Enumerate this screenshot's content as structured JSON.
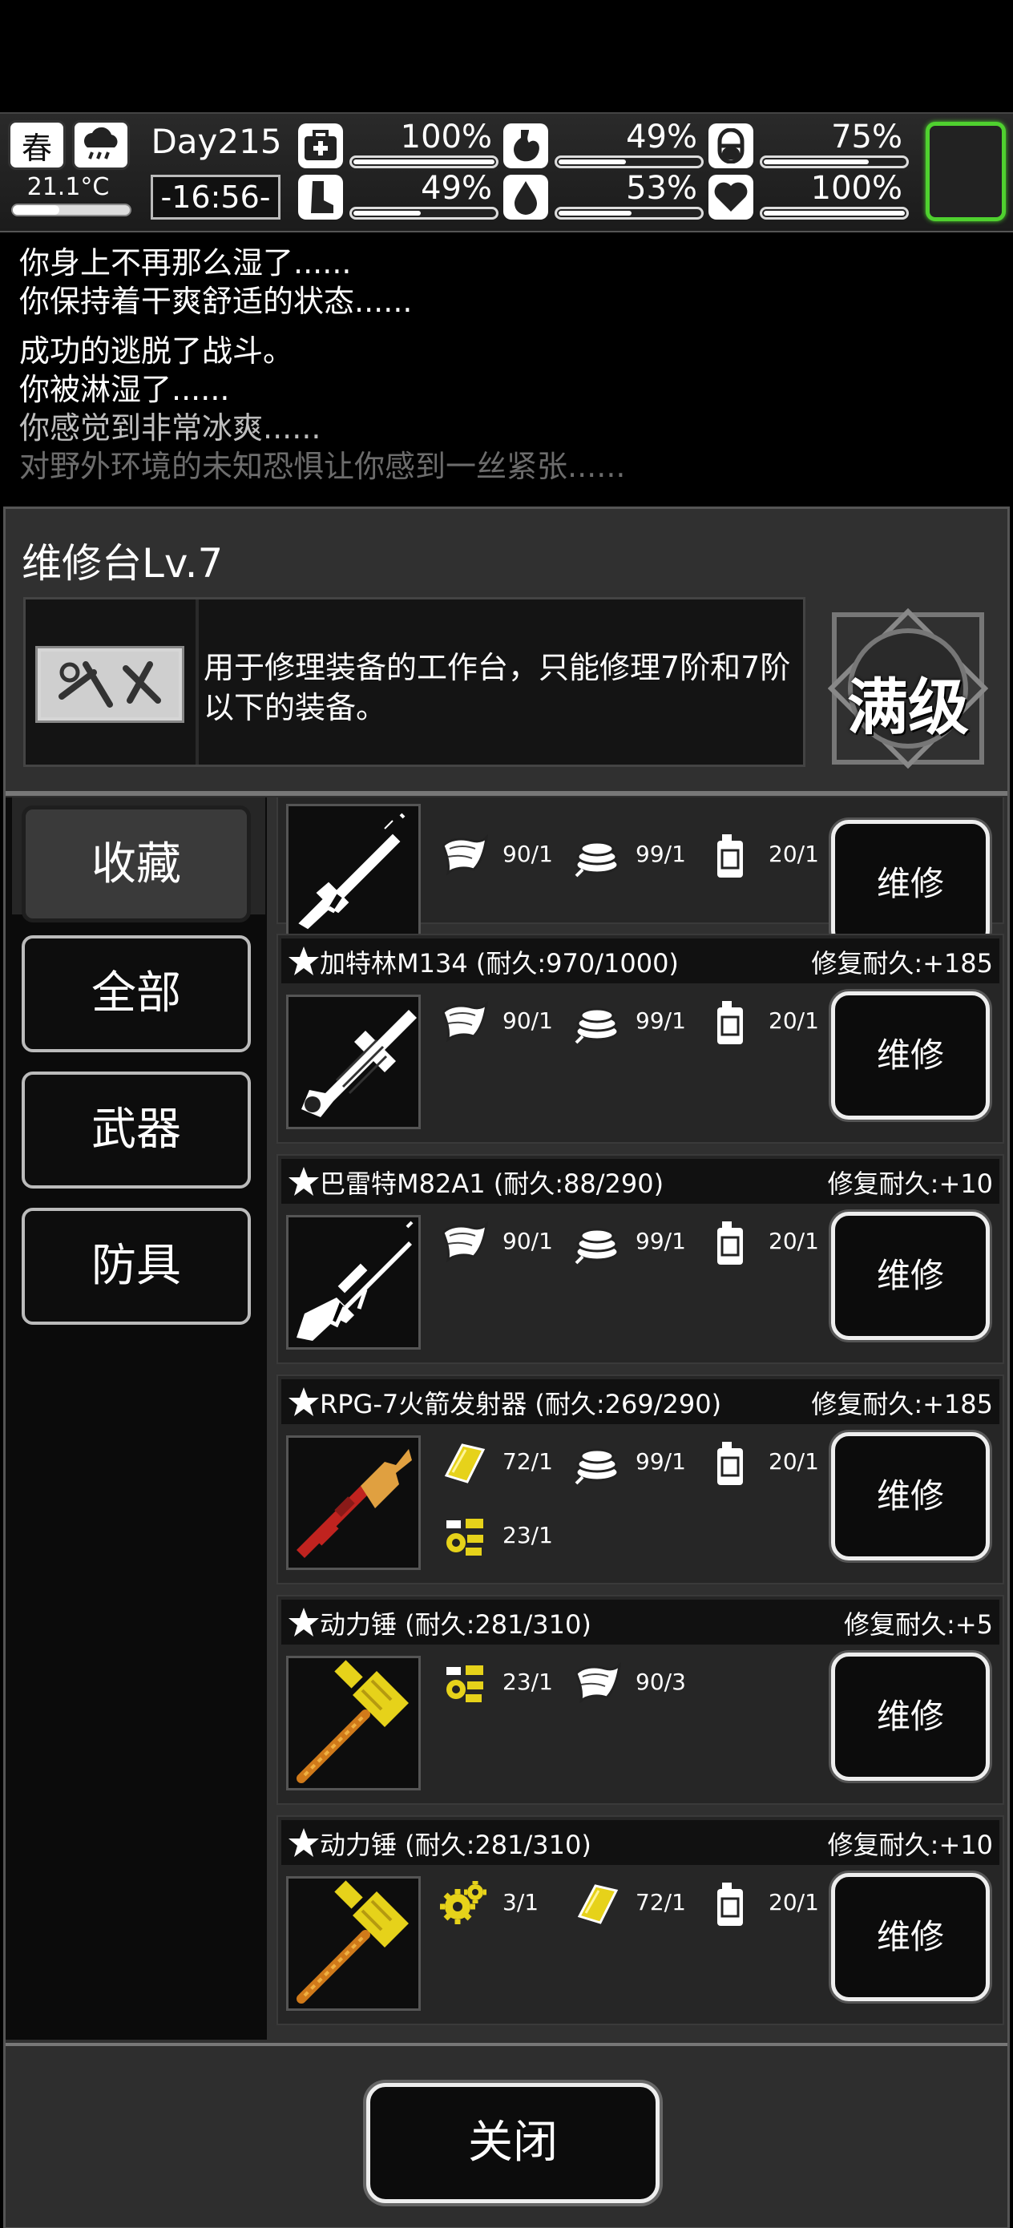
{
  "status": {
    "season": "春",
    "weather_icon": "rain-cloud-icon",
    "temperature": "21.1°C",
    "day": "Day215",
    "time": "-16:56-",
    "stats": [
      {
        "name": "health",
        "icon": "medkit-icon",
        "value": "100%",
        "level": 1.0
      },
      {
        "name": "stomach",
        "icon": "stomach-icon",
        "value": "49%",
        "level": 0.49
      },
      {
        "name": "capsule",
        "icon": "pill-icon",
        "value": "75%",
        "level": 0.75
      },
      {
        "name": "stamina",
        "icon": "boot-icon",
        "value": "49%",
        "level": 0.49
      },
      {
        "name": "water",
        "icon": "water-drop-icon",
        "value": "53%",
        "level": 0.53
      },
      {
        "name": "mood",
        "icon": "heart-icon",
        "value": "100%",
        "level": 1.0
      }
    ],
    "accent_green": "#4fd12f"
  },
  "log": [
    "你身上不再那么湿了......",
    "你保持着干爽舒适的状态......",
    "成功的逃脱了战斗。",
    "你被淋湿了......",
    "你感觉到非常冰爽......",
    "对野外环境的未知恐惧让你感到一丝紧张......"
  ],
  "panel": {
    "title": "维修台Lv.7",
    "description": "用于修理装备的工作台，只能修理7阶和7阶以下的装备。",
    "max_level": "满级"
  },
  "tabs": [
    "收藏",
    "全部",
    "武器",
    "防具"
  ],
  "items": [
    {
      "name": "",
      "bonus": "",
      "weapon": "rifle",
      "materials": [
        {
          "icon": "cloth-icon",
          "text": "90/1"
        },
        {
          "icon": "rope-icon",
          "text": "99/1"
        },
        {
          "icon": "oil-can-icon",
          "text": "20/1"
        }
      ],
      "repair": "维修"
    },
    {
      "name": "加特林M134 (耐久:970/1000)",
      "bonus": "修复耐久:+185",
      "weapon": "gatling",
      "materials": [
        {
          "icon": "cloth-icon",
          "text": "90/1"
        },
        {
          "icon": "rope-icon",
          "text": "99/1"
        },
        {
          "icon": "oil-can-icon",
          "text": "20/1"
        }
      ],
      "repair": "维修"
    },
    {
      "name": "巴雷特M82A1 (耐久:88/290)",
      "bonus": "修复耐久:+10",
      "weapon": "sniper",
      "materials": [
        {
          "icon": "cloth-icon",
          "text": "90/1"
        },
        {
          "icon": "rope-icon",
          "text": "99/1"
        },
        {
          "icon": "oil-can-icon",
          "text": "20/1"
        }
      ],
      "repair": "维修"
    },
    {
      "name": "RPG-7火箭发射器 (耐久:269/290)",
      "bonus": "修复耐久:+185",
      "weapon": "rpg",
      "materials": [
        {
          "icon": "gold-plate-icon",
          "text": "72/1"
        },
        {
          "icon": "rope-icon",
          "text": "99/1"
        },
        {
          "icon": "oil-can-icon",
          "text": "20/1"
        },
        {
          "icon": "parts-icon",
          "text": "23/1"
        }
      ],
      "repair": "维修"
    },
    {
      "name": "动力锤 (耐久:281/310)",
      "bonus": "修复耐久:+5",
      "weapon": "hammer",
      "materials": [
        {
          "icon": "parts-icon",
          "text": "23/1"
        },
        {
          "icon": "cloth-icon",
          "text": "90/3"
        }
      ],
      "repair": "维修"
    },
    {
      "name": "动力锤 (耐久:281/310)",
      "bonus": "修复耐久:+10",
      "weapon": "hammer",
      "materials": [
        {
          "icon": "gear-icon",
          "text": "3/1"
        },
        {
          "icon": "gold-plate-icon",
          "text": "72/1"
        },
        {
          "icon": "oil-can-icon",
          "text": "20/1"
        }
      ],
      "repair": "维修"
    }
  ],
  "close_label": "关闭"
}
